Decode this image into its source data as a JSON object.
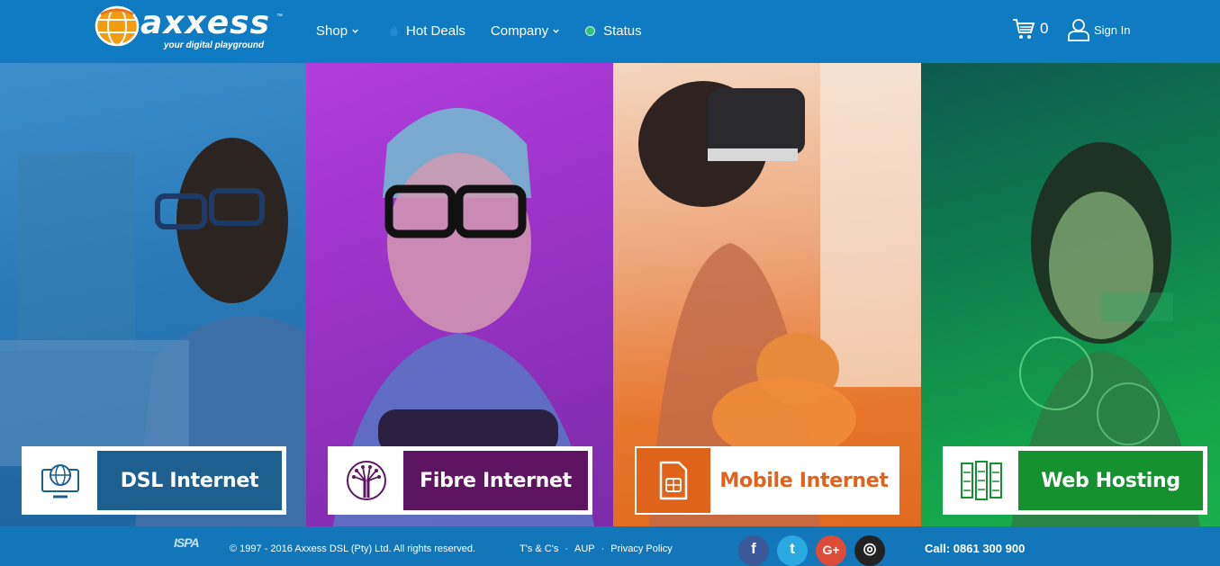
{
  "brand": {
    "name": "axxess",
    "tagline": "your digital playground",
    "logo_colors": [
      "#f39c12",
      "#e8731c"
    ]
  },
  "nav": {
    "items": [
      {
        "label": "Shop",
        "dropdown": true
      },
      {
        "label": "Hot Deals",
        "icon": "flame-icon"
      },
      {
        "label": "Company",
        "dropdown": true
      },
      {
        "label": "Status",
        "icon": "status-dot-icon",
        "status_color": "#2ec27e"
      }
    ]
  },
  "cart": {
    "count": "0",
    "icon": "cart-icon"
  },
  "account": {
    "signin_label": "Sign In",
    "icon": "user-icon"
  },
  "panels": [
    {
      "label": "DSL Internet",
      "icon": "globe-monitor-icon",
      "color": "#1d5f8f"
    },
    {
      "label": "Fibre Internet",
      "icon": "fibre-optic-icon",
      "color": "#5e1561"
    },
    {
      "label": "Mobile Internet",
      "icon": "sim-card-icon",
      "color": "#e0631c"
    },
    {
      "label": "Web Hosting",
      "icon": "server-rack-icon",
      "color": "#16912f"
    }
  ],
  "footer": {
    "ispa": "ISPA",
    "copyright": "© 1997 - 2016 Axxess DSL (Pty) Ltd. All rights reserved.",
    "links": [
      "T's & C's",
      "AUP",
      "Privacy Policy"
    ],
    "separator": "·",
    "socials": [
      {
        "name": "facebook-icon",
        "glyph": "f"
      },
      {
        "name": "twitter-icon",
        "glyph": "t"
      },
      {
        "name": "google-plus-icon",
        "glyph": "G+"
      },
      {
        "name": "instagram-icon",
        "glyph": "◎"
      }
    ],
    "call": "Call: 0861 300 900"
  }
}
